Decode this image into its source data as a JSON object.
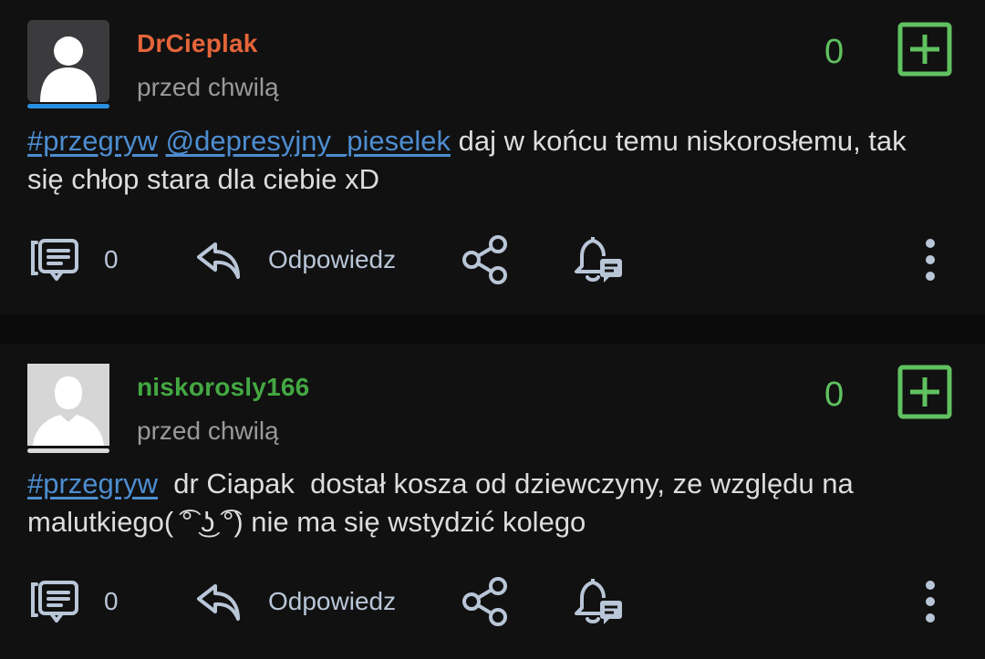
{
  "posts": [
    {
      "username": "DrCieplak",
      "username_color": "#e5643a",
      "timestamp": "przed chwilą",
      "votes": "0",
      "content": {
        "tag": "#przegryw",
        "sep1": " ",
        "mention": "@depresyjny_pieselek",
        "text": " daj w końcu temu niskorosłemu, tak się chłop stara dla ciebie xD"
      },
      "comments_count": "0",
      "reply_label": "Odpowiedz"
    },
    {
      "username": "niskorosly166",
      "username_color": "#43a843",
      "timestamp": "przed chwilą",
      "votes": "0",
      "content": {
        "tag": "#przegryw",
        "text": "  dr Ciapak  dostał kosza od dziewczyny, ze względu na malutkiego( ͡° ͜ʖ ͡°) nie ma się wstydzić kolego"
      },
      "comments_count": "0",
      "reply_label": "Odpowiedz"
    }
  ],
  "colors": {
    "background": "#111111",
    "accent_green": "#5fc15f",
    "link_blue": "#4d8dd0",
    "icon_color": "#b9c6d8",
    "muted_text": "#9a9a9a"
  },
  "icons": {
    "comments": "comments-icon",
    "reply": "reply-arrow-icon",
    "share": "share-icon",
    "notify": "bell-notification-icon",
    "more": "more-vertical-icon",
    "vote": "plus-square-icon",
    "avatar": "default-avatar-icon"
  }
}
